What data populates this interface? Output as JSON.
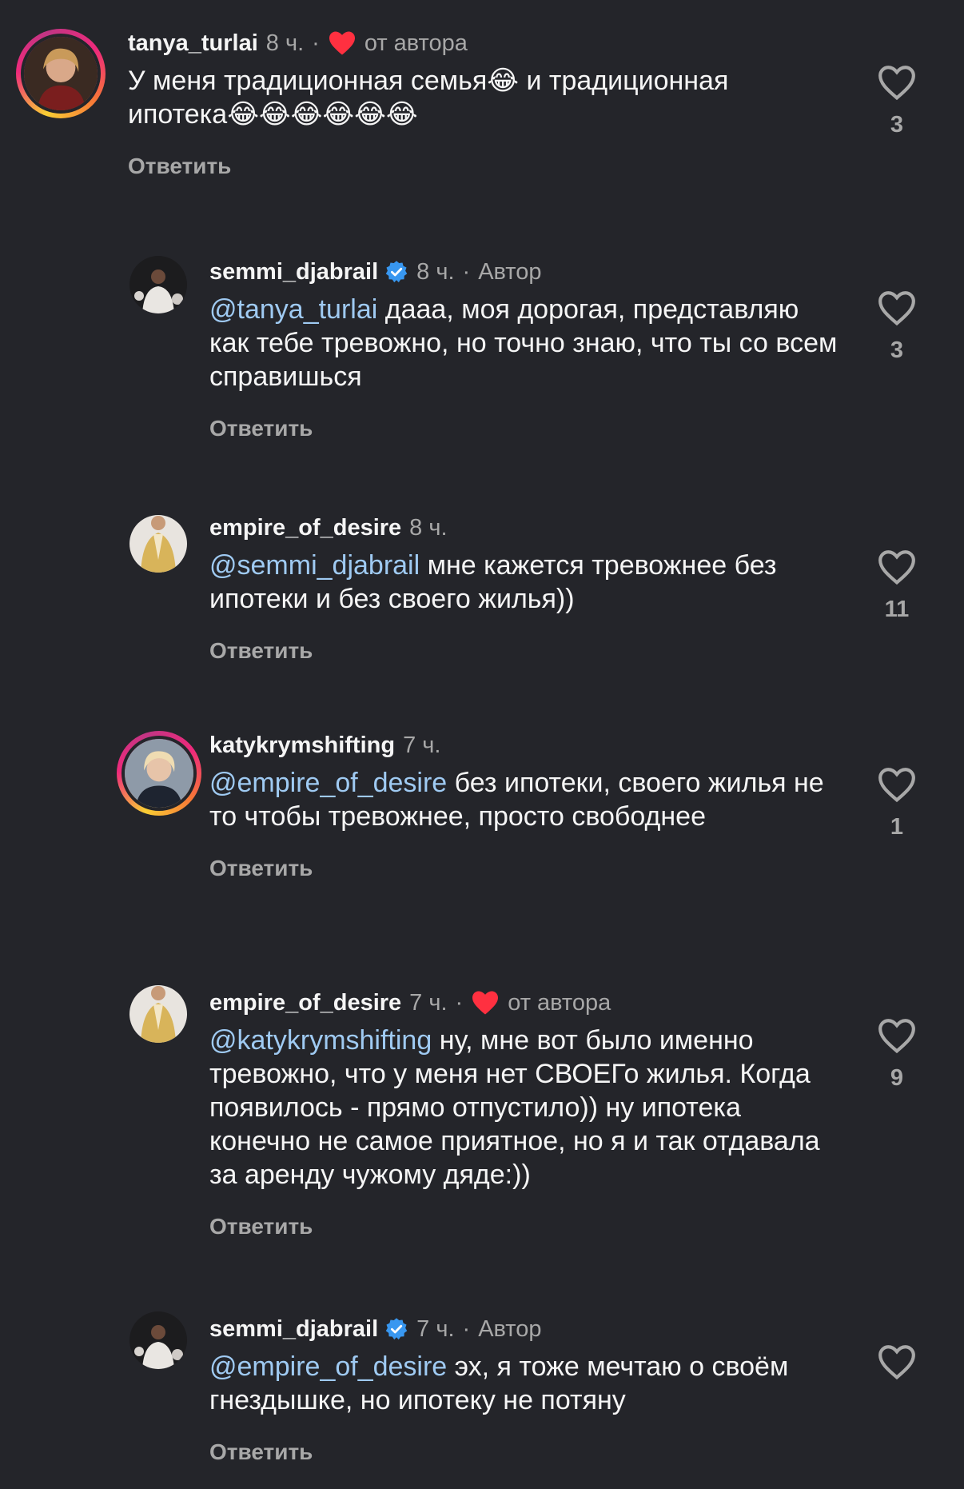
{
  "comments": [
    {
      "username": "tanya_turlai",
      "time": "8 ч.",
      "dot": "·",
      "liked_by_author": "от автора",
      "text_line1": "У меня традиционная семья😂 и традиционная",
      "text_line2": "ипотека😂😂😂😂😂😂",
      "reply": "Ответить",
      "likes": "3"
    },
    {
      "username": "semmi_djabrail",
      "time": "8 ч.",
      "dot": "·",
      "author_tag": "Автор",
      "mention": "@tanya_turlai",
      "text": " дааа, моя дорогая, представляю как тебе тревожно, но точно знаю, что ты со всем справишься",
      "reply": "Ответить",
      "likes": "3"
    },
    {
      "username": "empire_of_desire",
      "time": "8 ч.",
      "mention": "@semmi_djabrail",
      "text": " мне кажется тревожнее без ипотеки и без своего жилья))",
      "reply": "Ответить",
      "likes": "11"
    },
    {
      "username": "katykrymshifting",
      "time": "7 ч.",
      "mention": "@empire_of_desire",
      "text": " без ипотеки, своего жилья не то чтобы тревожнее, просто свободнее",
      "reply": "Ответить",
      "likes": "1"
    },
    {
      "username": "empire_of_desire",
      "time": "7 ч.",
      "dot": "·",
      "liked_by_author": "от автора",
      "mention": "@katykrymshifting",
      "text": " ну, мне вот было именно тревожно, что у меня нет СВОЕГо жилья. Когда появилось - прямо отпустило)) ну ипотека конечно не самое приятное, но я и так отдавала за аренду чужому дяде:))",
      "reply": "Ответить",
      "likes": "9"
    },
    {
      "username": "semmi_djabrail",
      "time": "7 ч.",
      "dot": "·",
      "author_tag": "Автор",
      "mention": "@empire_of_desire",
      "text": " эх, я тоже мечтаю о своём гнездышке, но ипотеку не потяну",
      "reply": "Ответить"
    }
  ],
  "colors": {
    "background": "#24252a",
    "mention": "#9fcaf2",
    "secondary": "#a8a8a8",
    "heart_red": "#ff3040",
    "verified": "#3897f0"
  },
  "icons": {
    "like": "heart-outline-icon",
    "liked_by_author": "heart-filled-icon",
    "verified": "verified-badge-icon"
  }
}
